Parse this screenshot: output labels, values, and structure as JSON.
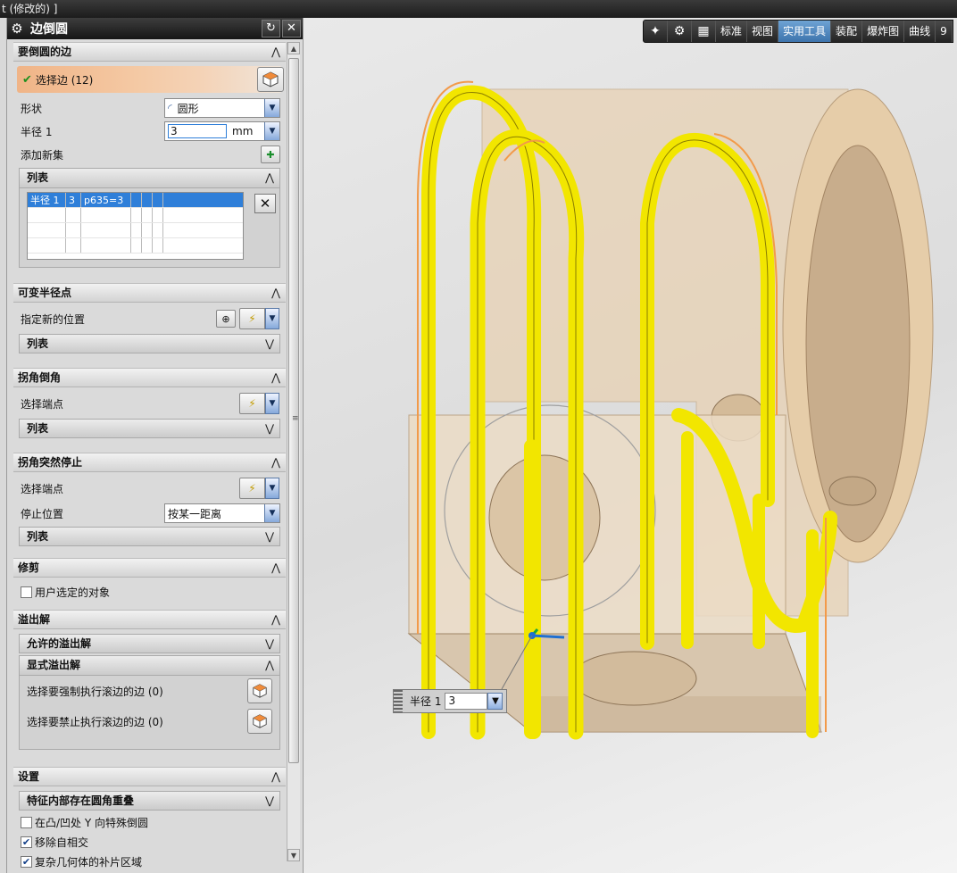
{
  "window_title": "t (修改的) ]",
  "dialog": {
    "title": "边倒圆",
    "sections": {
      "edges": {
        "title": "要倒圆的边",
        "select_edge": "选择边 (12)",
        "shape_label": "形状",
        "shape_value": "圆形",
        "radius_label": "半径 1",
        "radius_value": "3",
        "radius_unit": "mm",
        "add_set_label": "添加新集",
        "list_title": "列表",
        "list_rows": [
          [
            "半径 1",
            "3",
            "p635=3",
            "",
            "",
            "",
            ""
          ],
          [
            "",
            "",
            "",
            "",
            "",
            "",
            ""
          ],
          [
            "",
            "",
            "",
            "",
            "",
            "",
            ""
          ],
          [
            "",
            "",
            "",
            "",
            "",
            "",
            ""
          ]
        ]
      },
      "variable_radius": {
        "title": "可变半径点",
        "new_location_label": "指定新的位置",
        "list_title": "列表"
      },
      "corner_setback": {
        "title": "拐角倒角",
        "select_endpoint_label": "选择端点",
        "list_title": "列表"
      },
      "corner_stop": {
        "title": "拐角突然停止",
        "select_endpoint_label": "选择端点",
        "stop_position_label": "停止位置",
        "stop_position_value": "按某一距离",
        "list_title": "列表"
      },
      "trim": {
        "title": "修剪",
        "user_selected_label": "用户选定的对象",
        "user_selected_checked": false
      },
      "overflow": {
        "title": "溢出解",
        "allowed_label": "允许的溢出解",
        "explicit_label": "显式溢出解",
        "force_roll_label": "选择要强制执行滚边的边 (0)",
        "prevent_roll_label": "选择要禁止执行滚边的边 (0)"
      },
      "settings": {
        "title": "设置",
        "overlap_label": "特征内部存在圆角重叠",
        "options": [
          {
            "label": "在凸/凹处 Y 向特殊倒圆",
            "checked": false
          },
          {
            "label": "移除自相交",
            "checked": true
          },
          {
            "label": "复杂几何体的补片区域",
            "checked": true
          }
        ]
      }
    }
  },
  "toolbar": {
    "items": [
      "标准",
      "视图",
      "实用工具",
      "装配",
      "爆炸图",
      "曲线",
      "9"
    ],
    "active": "实用工具"
  },
  "floating_input": {
    "label": "半径 1",
    "value": "3"
  },
  "icons": [
    "gear-icon",
    "reset-icon",
    "close-icon",
    "cube-select-icon",
    "add-set-icon",
    "delete-icon",
    "point-dialog-icon",
    "chevron-up-icon",
    "chevron-down-icon"
  ],
  "colors": {
    "fillet_yellow": "#f2e600",
    "part_tan": "#e8d2b4",
    "edge_orange": "#f29a4a",
    "selected_row": "#2f7fd9",
    "select_bar": "#f0b487"
  }
}
